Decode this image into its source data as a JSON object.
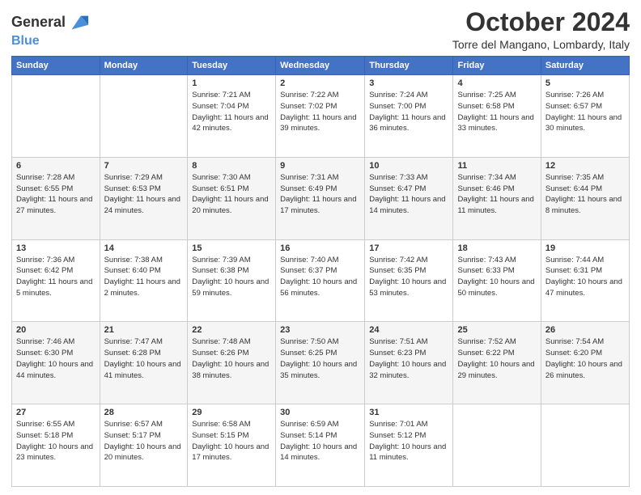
{
  "header": {
    "logo_line1": "General",
    "logo_line2": "Blue",
    "month": "October 2024",
    "location": "Torre del Mangano, Lombardy, Italy"
  },
  "weekdays": [
    "Sunday",
    "Monday",
    "Tuesday",
    "Wednesday",
    "Thursday",
    "Friday",
    "Saturday"
  ],
  "weeks": [
    [
      {
        "day": "",
        "info": ""
      },
      {
        "day": "",
        "info": ""
      },
      {
        "day": "1",
        "info": "Sunrise: 7:21 AM\nSunset: 7:04 PM\nDaylight: 11 hours and 42 minutes."
      },
      {
        "day": "2",
        "info": "Sunrise: 7:22 AM\nSunset: 7:02 PM\nDaylight: 11 hours and 39 minutes."
      },
      {
        "day": "3",
        "info": "Sunrise: 7:24 AM\nSunset: 7:00 PM\nDaylight: 11 hours and 36 minutes."
      },
      {
        "day": "4",
        "info": "Sunrise: 7:25 AM\nSunset: 6:58 PM\nDaylight: 11 hours and 33 minutes."
      },
      {
        "day": "5",
        "info": "Sunrise: 7:26 AM\nSunset: 6:57 PM\nDaylight: 11 hours and 30 minutes."
      }
    ],
    [
      {
        "day": "6",
        "info": "Sunrise: 7:28 AM\nSunset: 6:55 PM\nDaylight: 11 hours and 27 minutes."
      },
      {
        "day": "7",
        "info": "Sunrise: 7:29 AM\nSunset: 6:53 PM\nDaylight: 11 hours and 24 minutes."
      },
      {
        "day": "8",
        "info": "Sunrise: 7:30 AM\nSunset: 6:51 PM\nDaylight: 11 hours and 20 minutes."
      },
      {
        "day": "9",
        "info": "Sunrise: 7:31 AM\nSunset: 6:49 PM\nDaylight: 11 hours and 17 minutes."
      },
      {
        "day": "10",
        "info": "Sunrise: 7:33 AM\nSunset: 6:47 PM\nDaylight: 11 hours and 14 minutes."
      },
      {
        "day": "11",
        "info": "Sunrise: 7:34 AM\nSunset: 6:46 PM\nDaylight: 11 hours and 11 minutes."
      },
      {
        "day": "12",
        "info": "Sunrise: 7:35 AM\nSunset: 6:44 PM\nDaylight: 11 hours and 8 minutes."
      }
    ],
    [
      {
        "day": "13",
        "info": "Sunrise: 7:36 AM\nSunset: 6:42 PM\nDaylight: 11 hours and 5 minutes."
      },
      {
        "day": "14",
        "info": "Sunrise: 7:38 AM\nSunset: 6:40 PM\nDaylight: 11 hours and 2 minutes."
      },
      {
        "day": "15",
        "info": "Sunrise: 7:39 AM\nSunset: 6:38 PM\nDaylight: 10 hours and 59 minutes."
      },
      {
        "day": "16",
        "info": "Sunrise: 7:40 AM\nSunset: 6:37 PM\nDaylight: 10 hours and 56 minutes."
      },
      {
        "day": "17",
        "info": "Sunrise: 7:42 AM\nSunset: 6:35 PM\nDaylight: 10 hours and 53 minutes."
      },
      {
        "day": "18",
        "info": "Sunrise: 7:43 AM\nSunset: 6:33 PM\nDaylight: 10 hours and 50 minutes."
      },
      {
        "day": "19",
        "info": "Sunrise: 7:44 AM\nSunset: 6:31 PM\nDaylight: 10 hours and 47 minutes."
      }
    ],
    [
      {
        "day": "20",
        "info": "Sunrise: 7:46 AM\nSunset: 6:30 PM\nDaylight: 10 hours and 44 minutes."
      },
      {
        "day": "21",
        "info": "Sunrise: 7:47 AM\nSunset: 6:28 PM\nDaylight: 10 hours and 41 minutes."
      },
      {
        "day": "22",
        "info": "Sunrise: 7:48 AM\nSunset: 6:26 PM\nDaylight: 10 hours and 38 minutes."
      },
      {
        "day": "23",
        "info": "Sunrise: 7:50 AM\nSunset: 6:25 PM\nDaylight: 10 hours and 35 minutes."
      },
      {
        "day": "24",
        "info": "Sunrise: 7:51 AM\nSunset: 6:23 PM\nDaylight: 10 hours and 32 minutes."
      },
      {
        "day": "25",
        "info": "Sunrise: 7:52 AM\nSunset: 6:22 PM\nDaylight: 10 hours and 29 minutes."
      },
      {
        "day": "26",
        "info": "Sunrise: 7:54 AM\nSunset: 6:20 PM\nDaylight: 10 hours and 26 minutes."
      }
    ],
    [
      {
        "day": "27",
        "info": "Sunrise: 6:55 AM\nSunset: 5:18 PM\nDaylight: 10 hours and 23 minutes."
      },
      {
        "day": "28",
        "info": "Sunrise: 6:57 AM\nSunset: 5:17 PM\nDaylight: 10 hours and 20 minutes."
      },
      {
        "day": "29",
        "info": "Sunrise: 6:58 AM\nSunset: 5:15 PM\nDaylight: 10 hours and 17 minutes."
      },
      {
        "day": "30",
        "info": "Sunrise: 6:59 AM\nSunset: 5:14 PM\nDaylight: 10 hours and 14 minutes."
      },
      {
        "day": "31",
        "info": "Sunrise: 7:01 AM\nSunset: 5:12 PM\nDaylight: 10 hours and 11 minutes."
      },
      {
        "day": "",
        "info": ""
      },
      {
        "day": "",
        "info": ""
      }
    ]
  ]
}
